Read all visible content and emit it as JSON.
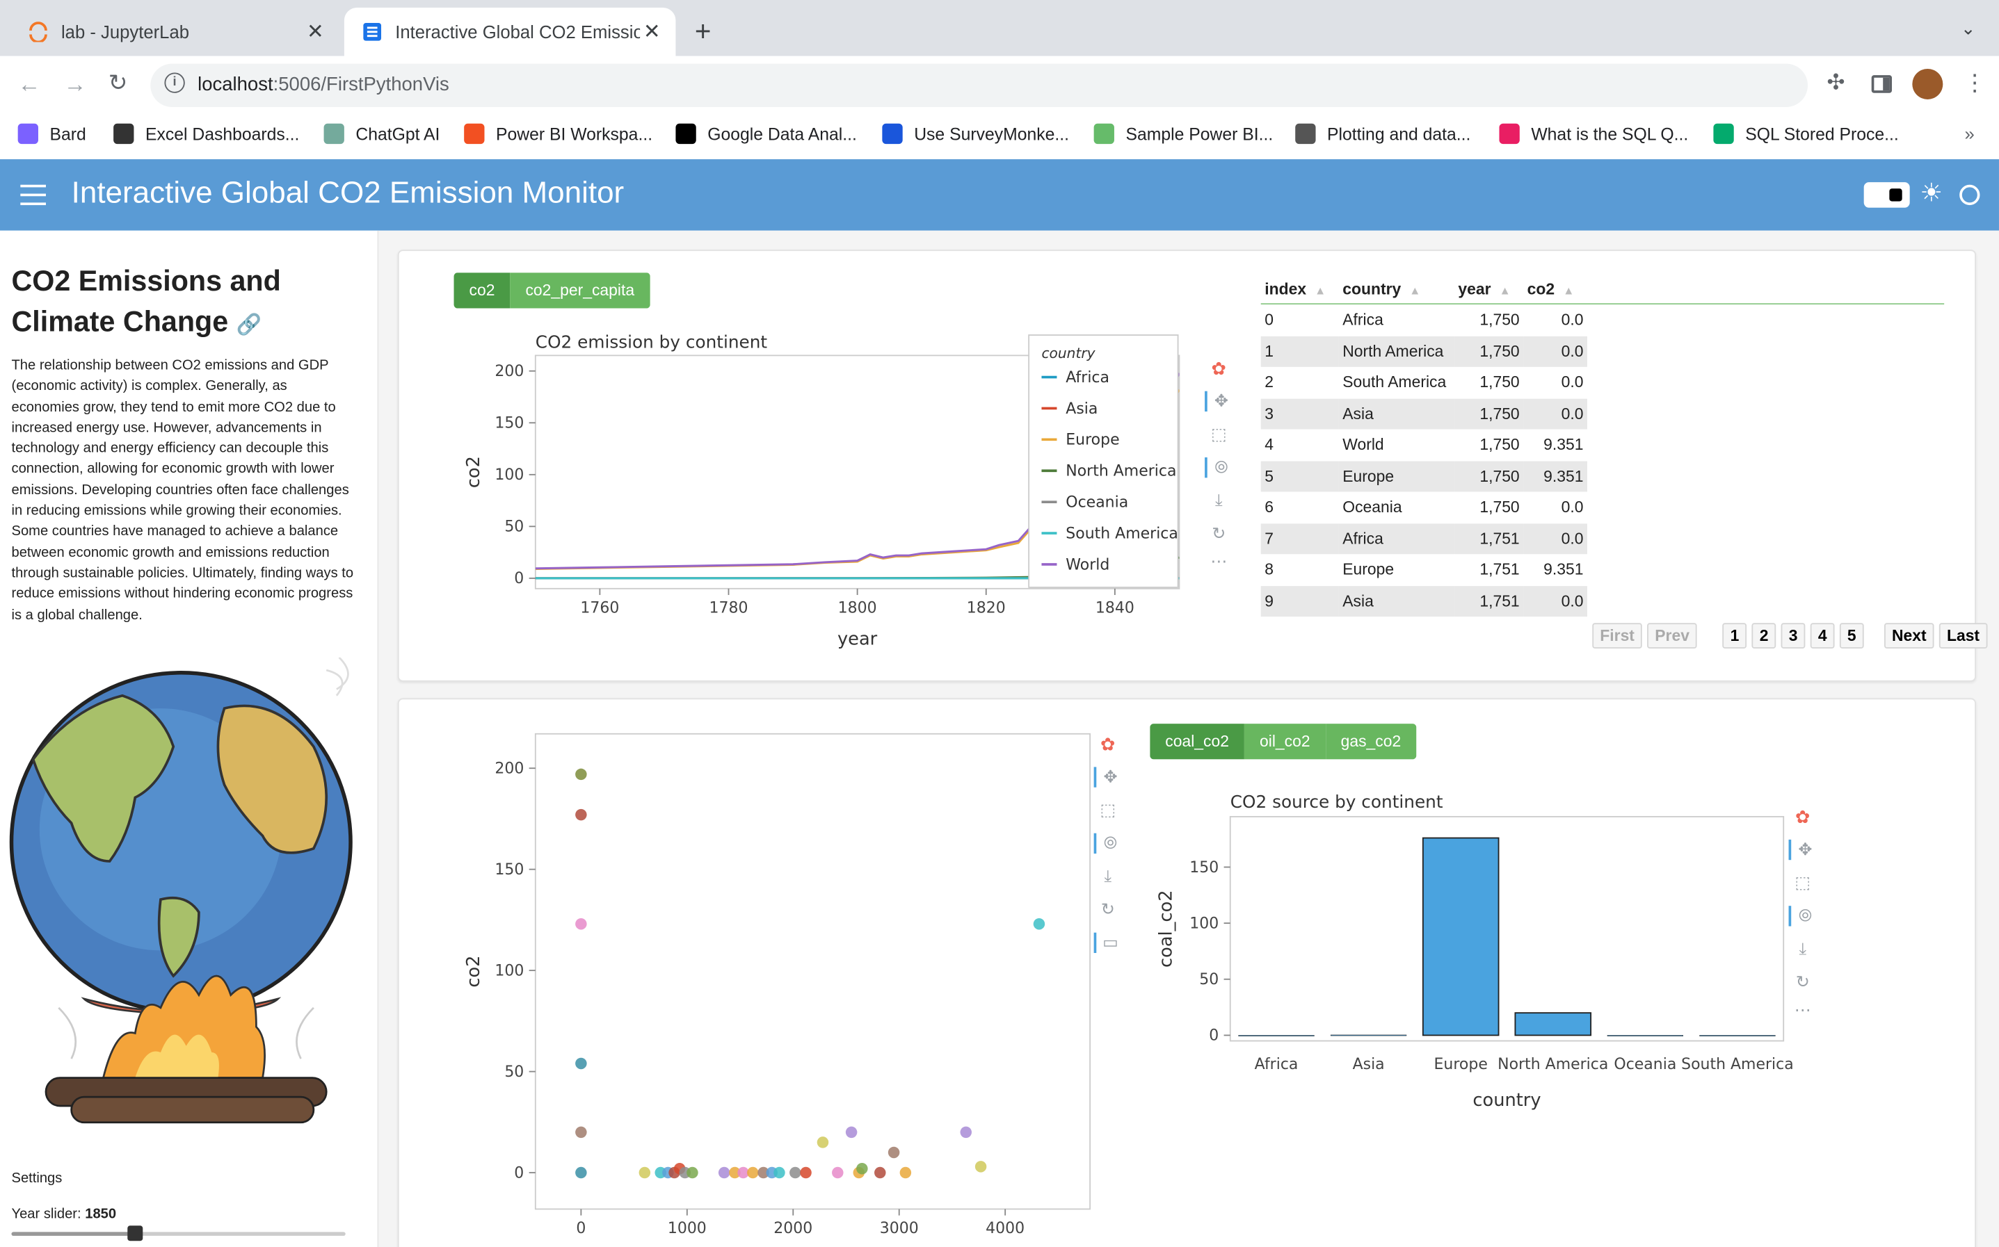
{
  "browser": {
    "tabs": [
      {
        "label": "lab - JupyterLab",
        "active": false
      },
      {
        "label": "Interactive Global CO2 Emissio",
        "active": true
      }
    ],
    "url_host": "localhost",
    "url_path": ":5006/FirstPythonVis",
    "bookmarks": [
      {
        "label": "Bard",
        "icon": "bard-icon",
        "color": "#7b61ff"
      },
      {
        "label": "Excel Dashboards...",
        "icon": "person-icon",
        "color": "#333333"
      },
      {
        "label": "ChatGpt AI",
        "icon": "chatgpt-icon",
        "color": "#74aa9c"
      },
      {
        "label": "Power BI Workspa...",
        "icon": "microsoft-icon",
        "color": "#f25022"
      },
      {
        "label": "Google Data Anal...",
        "icon": "coursera-icon",
        "color": "#000000"
      },
      {
        "label": "Use SurveyMonke...",
        "icon": "c-icon",
        "color": "#1a56db"
      },
      {
        "label": "Sample Power BI...",
        "icon": "chart-icon",
        "color": "#66bb6a"
      },
      {
        "label": "Plotting and data...",
        "icon": "globe-icon",
        "color": "#555555"
      },
      {
        "label": "What is the SQL Q...",
        "icon": "cube-icon",
        "color": "#e91e63"
      },
      {
        "label": "SQL Stored Proce...",
        "icon": "w3-icon",
        "color": "#04aa6d"
      }
    ],
    "bookmark_more": "»"
  },
  "app": {
    "title": "Interactive Global CO2 Emission Monitor",
    "header_color": "#5a9bd5"
  },
  "sidebar": {
    "heading_line1": "CO2 Emissions and",
    "heading_line2": "Climate Change",
    "paragraph": "The relationship between CO2 emissions and GDP (economic activity) is complex. Generally, as economies grow, they tend to emit more CO2 due to increased energy use. However, advancements in technology and energy efficiency can decouple this connection, allowing for economic growth with lower emissions. Developing countries often face challenges in reducing emissions while growing their economies. Some countries have managed to achieve a balance between economic growth and emissions reduction through sustainable policies. Ultimately, finding ways to reduce emissions without hindering economic progress is a global challenge.",
    "settings_label": "Settings",
    "slider_label": "Year slider: ",
    "slider_value": "1850",
    "slider_fraction": 0.37
  },
  "top_card": {
    "toggle": [
      "co2",
      "co2_per_capita"
    ],
    "toggle_active": 0,
    "table": {
      "headers": [
        "index",
        "country",
        "year",
        "co2"
      ],
      "rows": [
        [
          "0",
          "Africa",
          "1,750",
          "0.0"
        ],
        [
          "1",
          "North America",
          "1,750",
          "0.0"
        ],
        [
          "2",
          "South America",
          "1,750",
          "0.0"
        ],
        [
          "3",
          "Asia",
          "1,750",
          "0.0"
        ],
        [
          "4",
          "World",
          "1,750",
          "9.351"
        ],
        [
          "5",
          "Europe",
          "1,750",
          "9.351"
        ],
        [
          "6",
          "Oceania",
          "1,750",
          "0.0"
        ],
        [
          "7",
          "Africa",
          "1,751",
          "0.0"
        ],
        [
          "8",
          "Europe",
          "1,751",
          "9.351"
        ],
        [
          "9",
          "Asia",
          "1,751",
          "0.0"
        ]
      ]
    },
    "pager": {
      "first": "First",
      "prev": "Prev",
      "pages": [
        "1",
        "2",
        "3",
        "4",
        "5"
      ],
      "next": "Next",
      "last": "Last"
    }
  },
  "bottom_card": {
    "toggle": [
      "coal_co2",
      "oil_co2",
      "gas_co2"
    ],
    "toggle_active": 0
  },
  "chart_data": [
    {
      "type": "line",
      "title": "CO2 emission by continent",
      "xlabel": "year",
      "ylabel": "co2",
      "xlim": [
        1750,
        1850
      ],
      "ylim": [
        -10,
        215
      ],
      "xticks": [
        1760,
        1780,
        1800,
        1820,
        1840
      ],
      "yticks": [
        0,
        50,
        100,
        150,
        200
      ],
      "legend_title": "country",
      "legend_position": "right-overlay",
      "series": [
        {
          "name": "Africa",
          "color": "#1f9cc4",
          "x": [
            1750,
            1850
          ],
          "y": [
            0,
            0
          ]
        },
        {
          "name": "Asia",
          "color": "#d6482c",
          "x": [
            1750,
            1850
          ],
          "y": [
            0,
            0.2
          ]
        },
        {
          "name": "Europe",
          "color": "#e9a83a",
          "x": [
            1750,
            1760,
            1770,
            1780,
            1790,
            1795,
            1800,
            1802,
            1804,
            1806,
            1808,
            1810,
            1815,
            1820,
            1822,
            1825,
            1827,
            1828,
            1830,
            1832,
            1834,
            1835,
            1838,
            1840,
            1842,
            1844,
            1846,
            1848,
            1850
          ],
          "y": [
            9,
            10,
            11,
            12,
            13,
            15,
            16,
            22,
            19,
            21,
            21,
            23,
            25,
            27,
            30,
            34,
            48,
            40,
            82,
            80,
            86,
            87,
            95,
            110,
            120,
            130,
            140,
            160,
            182
          ]
        },
        {
          "name": "North America",
          "color": "#4e7c3a",
          "x": [
            1750,
            1800,
            1820,
            1830,
            1835,
            1840,
            1845,
            1850
          ],
          "y": [
            0,
            0,
            0.5,
            1.5,
            3,
            6,
            11,
            20
          ]
        },
        {
          "name": "Oceania",
          "color": "#8c8c8c",
          "x": [
            1750,
            1850
          ],
          "y": [
            0,
            0
          ]
        },
        {
          "name": "South America",
          "color": "#3cc0c7",
          "x": [
            1750,
            1850
          ],
          "y": [
            0,
            0
          ]
        },
        {
          "name": "World",
          "color": "#9664c8",
          "x": [
            1750,
            1760,
            1770,
            1780,
            1790,
            1795,
            1800,
            1802,
            1804,
            1806,
            1808,
            1810,
            1815,
            1820,
            1822,
            1825,
            1827,
            1828,
            1830,
            1832,
            1834,
            1835,
            1838,
            1840,
            1842,
            1844,
            1846,
            1848,
            1850
          ],
          "y": [
            9.5,
            10.5,
            11.5,
            12.5,
            13.5,
            15.5,
            17,
            23,
            20,
            22,
            22,
            24,
            26,
            28,
            32,
            36,
            50,
            42,
            88,
            86,
            92,
            93,
            100,
            120,
            130,
            140,
            150,
            170,
            198
          ]
        }
      ]
    },
    {
      "type": "scatter",
      "title": "",
      "xlabel": "",
      "ylabel": "co2",
      "xlim": [
        -430,
        4800
      ],
      "ylim": [
        -18,
        217
      ],
      "xticks": [
        0,
        1000,
        2000,
        3000,
        4000
      ],
      "yticks": [
        0,
        50,
        100,
        150,
        200
      ],
      "points": [
        {
          "x": 0,
          "y": 197,
          "color": "#7d8c3a"
        },
        {
          "x": 0,
          "y": 177,
          "color": "#b24b3c"
        },
        {
          "x": 0,
          "y": 123,
          "color": "#e68ac9"
        },
        {
          "x": 0,
          "y": 54,
          "color": "#3a8fa6"
        },
        {
          "x": 0,
          "y": 20,
          "color": "#a07b6b"
        },
        {
          "x": 0,
          "y": 0,
          "color": "#3a8fa6"
        },
        {
          "x": 600,
          "y": 0,
          "color": "#d0c95a"
        },
        {
          "x": 750,
          "y": 0,
          "color": "#3cc0c7"
        },
        {
          "x": 820,
          "y": 0,
          "color": "#5aa0d8"
        },
        {
          "x": 880,
          "y": 0,
          "color": "#b24b3c"
        },
        {
          "x": 930,
          "y": 2,
          "color": "#d6482c"
        },
        {
          "x": 980,
          "y": 0,
          "color": "#8c8c8c"
        },
        {
          "x": 1050,
          "y": 0,
          "color": "#7aa84e"
        },
        {
          "x": 1350,
          "y": 0,
          "color": "#a88bd6"
        },
        {
          "x": 1450,
          "y": 0,
          "color": "#e9a83a"
        },
        {
          "x": 1530,
          "y": 0,
          "color": "#e68ac9"
        },
        {
          "x": 1620,
          "y": 0,
          "color": "#e9a83a"
        },
        {
          "x": 1720,
          "y": 0,
          "color": "#a07b6b"
        },
        {
          "x": 1800,
          "y": 0,
          "color": "#5aa0d8"
        },
        {
          "x": 1870,
          "y": 0,
          "color": "#3cc0c7"
        },
        {
          "x": 2020,
          "y": 0,
          "color": "#8c8c8c"
        },
        {
          "x": 2120,
          "y": 0,
          "color": "#d6482c"
        },
        {
          "x": 2280,
          "y": 15,
          "color": "#d0c95a"
        },
        {
          "x": 2420,
          "y": 0,
          "color": "#e68ac9"
        },
        {
          "x": 2550,
          "y": 20,
          "color": "#a88bd6"
        },
        {
          "x": 2620,
          "y": 0,
          "color": "#e9a83a"
        },
        {
          "x": 2650,
          "y": 2,
          "color": "#7aa84e"
        },
        {
          "x": 2820,
          "y": 0,
          "color": "#b24b3c"
        },
        {
          "x": 2950,
          "y": 10,
          "color": "#a07b6b"
        },
        {
          "x": 3060,
          "y": 0,
          "color": "#e9a83a"
        },
        {
          "x": 3630,
          "y": 20,
          "color": "#a88bd6"
        },
        {
          "x": 3770,
          "y": 3,
          "color": "#d0c95a"
        },
        {
          "x": 4320,
          "y": 123,
          "color": "#3cc0c7"
        }
      ]
    },
    {
      "type": "bar",
      "title": "CO2 source by continent",
      "xlabel": "country",
      "ylabel": "coal_co2",
      "categories": [
        "Africa",
        "Asia",
        "Europe",
        "North America",
        "Oceania",
        "South America"
      ],
      "values": [
        0,
        0.3,
        176,
        20,
        0,
        0
      ],
      "ylim": [
        -5,
        195
      ],
      "yticks": [
        0,
        50,
        100,
        150
      ],
      "bar_color": "#4aa3df"
    }
  ]
}
